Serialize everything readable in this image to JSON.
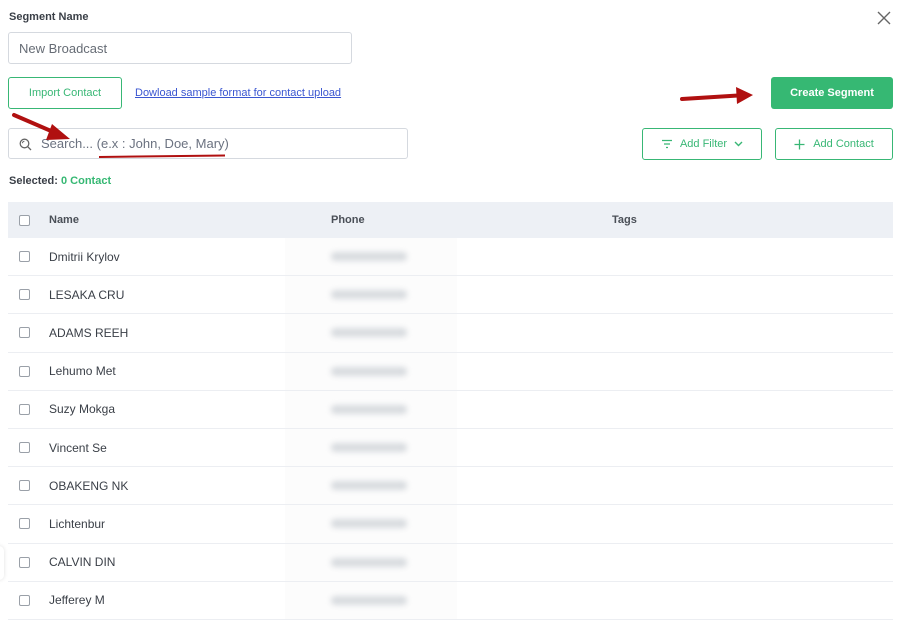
{
  "form": {
    "segment_name_label": "Segment Name",
    "segment_name_value": "New Broadcast",
    "import_button": "Import Contact",
    "download_link": "Dowload sample format for contact upload",
    "create_button": "Create Segment",
    "search_placeholder": "Search... (e.x : John, Doe, Mary)",
    "add_filter_button": "Add Filter",
    "add_contact_button": "Add Contact",
    "selected_label": "Selected:",
    "selected_count": "0 Contact"
  },
  "icons": {
    "close": "close-icon",
    "search": "search-icon",
    "filter": "filter-icon",
    "chevron": "chevron-down-icon",
    "plus": "plus-icon"
  },
  "colors": {
    "accent": "#36b873",
    "link": "#3a56d1",
    "annotation": "#b01010"
  },
  "table": {
    "columns": [
      "Name",
      "Phone",
      "Tags"
    ],
    "rows": [
      {
        "name": "Dmitrii Krylov",
        "phone": "[blurred]",
        "tags": ""
      },
      {
        "name": "LESAKA CRU",
        "phone": "[blurred]",
        "tags": ""
      },
      {
        "name": "ADAMS REEH",
        "phone": "[blurred]",
        "tags": ""
      },
      {
        "name": "Lehumo Met",
        "phone": "[blurred]",
        "tags": ""
      },
      {
        "name": "Suzy Mokga",
        "phone": "[blurred]",
        "tags": ""
      },
      {
        "name": "Vincent Se",
        "phone": "[blurred]",
        "tags": ""
      },
      {
        "name": "OBAKENG NK",
        "phone": "[blurred]",
        "tags": ""
      },
      {
        "name": "Lichtenbur",
        "phone": "[blurred]",
        "tags": ""
      },
      {
        "name": "CALVIN DIN",
        "phone": "[blurred]",
        "tags": ""
      },
      {
        "name": "Jefferey M",
        "phone": "[blurred]",
        "tags": ""
      }
    ]
  }
}
